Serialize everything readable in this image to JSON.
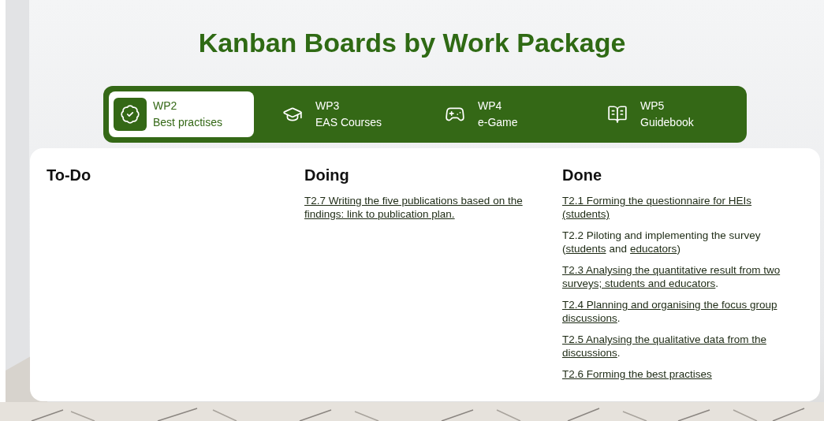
{
  "title": "Kanban Boards by Work Package",
  "tabs": [
    {
      "code": "WP2",
      "label": "Best practises",
      "kind": "badge",
      "selected": true
    },
    {
      "code": "WP3",
      "label": "EAS Courses",
      "kind": "cap",
      "selected": false
    },
    {
      "code": "WP4",
      "label": "e-Game",
      "kind": "gamepad",
      "selected": false
    },
    {
      "code": "WP5",
      "label": "Guidebook",
      "kind": "book",
      "selected": false
    }
  ],
  "columns": [
    {
      "heading": "To-Do"
    },
    {
      "heading": "Doing",
      "tasks": [
        {
          "lines": [
            [
              {
                "kind": "link",
                "text": "T2.7 Writing the five publications based on the"
              }
            ],
            [
              {
                "kind": "link",
                "text": "findings: link to publication plan."
              }
            ]
          ]
        }
      ]
    },
    {
      "heading": "Done",
      "tasks": [
        {
          "lines": [
            [
              {
                "kind": "link",
                "text": "T2.1 Forming the questionnaire for HEIs"
              }
            ],
            [
              {
                "kind": "link",
                "text": "(students)"
              }
            ]
          ]
        },
        {
          "lines": [
            [
              {
                "kind": "text",
                "text": "T2.2 Piloting and implementing the survey"
              }
            ],
            [
              {
                "kind": "text",
                "text": "("
              },
              {
                "kind": "link",
                "text": "students"
              },
              {
                "kind": "text",
                "text": "and"
              },
              {
                "kind": "link",
                "text": "educators"
              },
              {
                "kind": "text",
                "text": ")"
              }
            ]
          ]
        },
        {
          "lines": [
            [
              {
                "kind": "link",
                "text": "T2.3 Analysing the quantitative result from two"
              }
            ],
            [
              {
                "kind": "link",
                "text": "surveys; students and educators"
              },
              {
                "kind": "text",
                "text": "."
              }
            ]
          ]
        },
        {
          "lines": [
            [
              {
                "kind": "link",
                "text": "T2.4 Planning and organising the focus group"
              }
            ],
            [
              {
                "kind": "link",
                "text": "discussions"
              },
              {
                "kind": "text",
                "text": "."
              }
            ]
          ]
        },
        {
          "lines": [
            [
              {
                "kind": "link",
                "text": "T2.5 Analysing the qualitative data from the"
              }
            ],
            [
              {
                "kind": "link",
                "text": "discussions"
              },
              {
                "kind": "text",
                "text": "."
              }
            ]
          ]
        },
        {
          "lines": [
            [
              {
                "kind": "link",
                "text": "T2.6 Forming the best practises"
              }
            ]
          ]
        }
      ]
    }
  ]
}
